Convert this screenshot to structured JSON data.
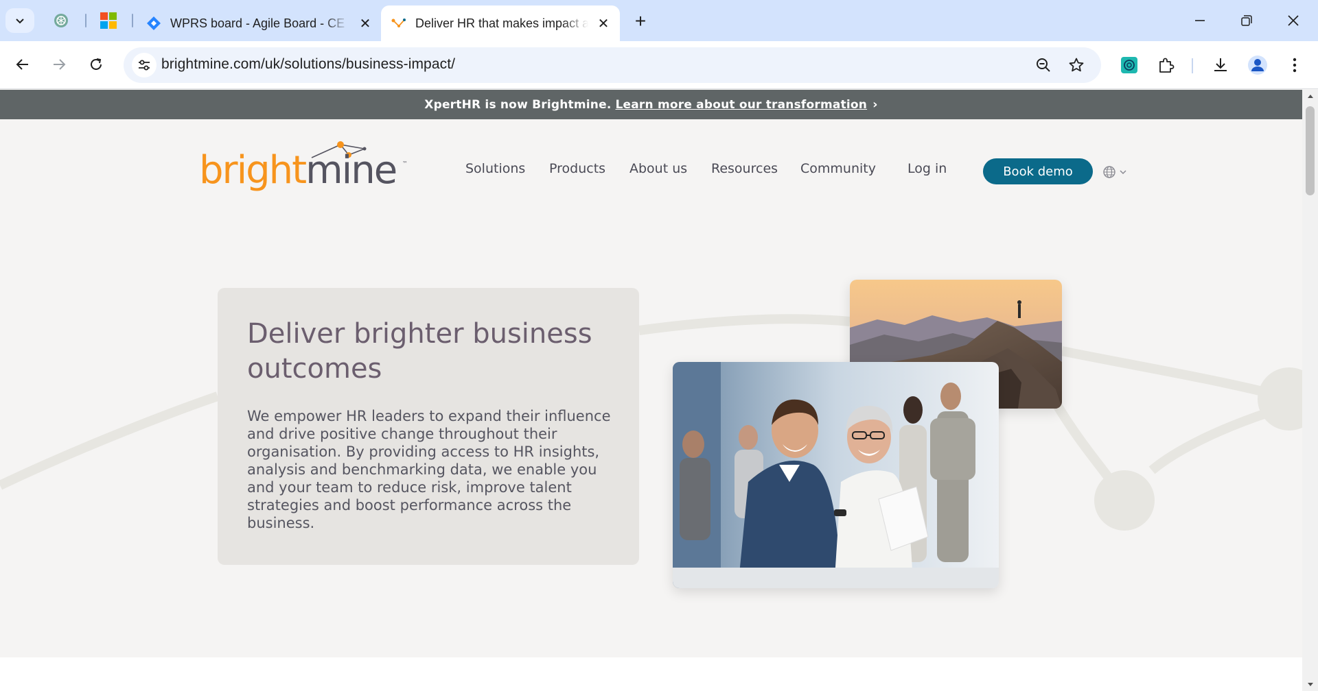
{
  "browser": {
    "tabs": [
      {
        "title": "WPRS board - Agile Board - CE",
        "active": false
      },
      {
        "title": "Deliver HR that makes impact across your business",
        "active": true
      }
    ],
    "url": "brightmine.com/uk/solutions/business-impact/",
    "colors": {
      "tabbar": "#d3e3fd",
      "omnibox": "#eef3fc"
    }
  },
  "banner": {
    "text": "XpertHR is now Brightmine.",
    "link": "Learn more about our transformation",
    "chevron": "›"
  },
  "site": {
    "logo_alt": "brightmine",
    "logo_bright": "bright",
    "logo_mine": "mine",
    "logo_tm": "™",
    "nav": [
      {
        "label": "Solutions"
      },
      {
        "label": "Products"
      },
      {
        "label": "About us"
      },
      {
        "label": "Resources"
      },
      {
        "label": "Community"
      },
      {
        "label": "Log in"
      }
    ],
    "cta": "Book demo",
    "colors": {
      "brand_orange": "#f7941d",
      "brand_teal": "#0b6a8a",
      "heading": "#6b5e6e"
    }
  },
  "hero": {
    "title": "Deliver brighter business outcomes",
    "body": "We empower HR leaders to expand their influence and drive positive change throughout their organisation. By providing access to HR insights, analysis and benchmarking data, we enable you and your team to reduce risk, improve talent strategies and boost performance across the business."
  }
}
